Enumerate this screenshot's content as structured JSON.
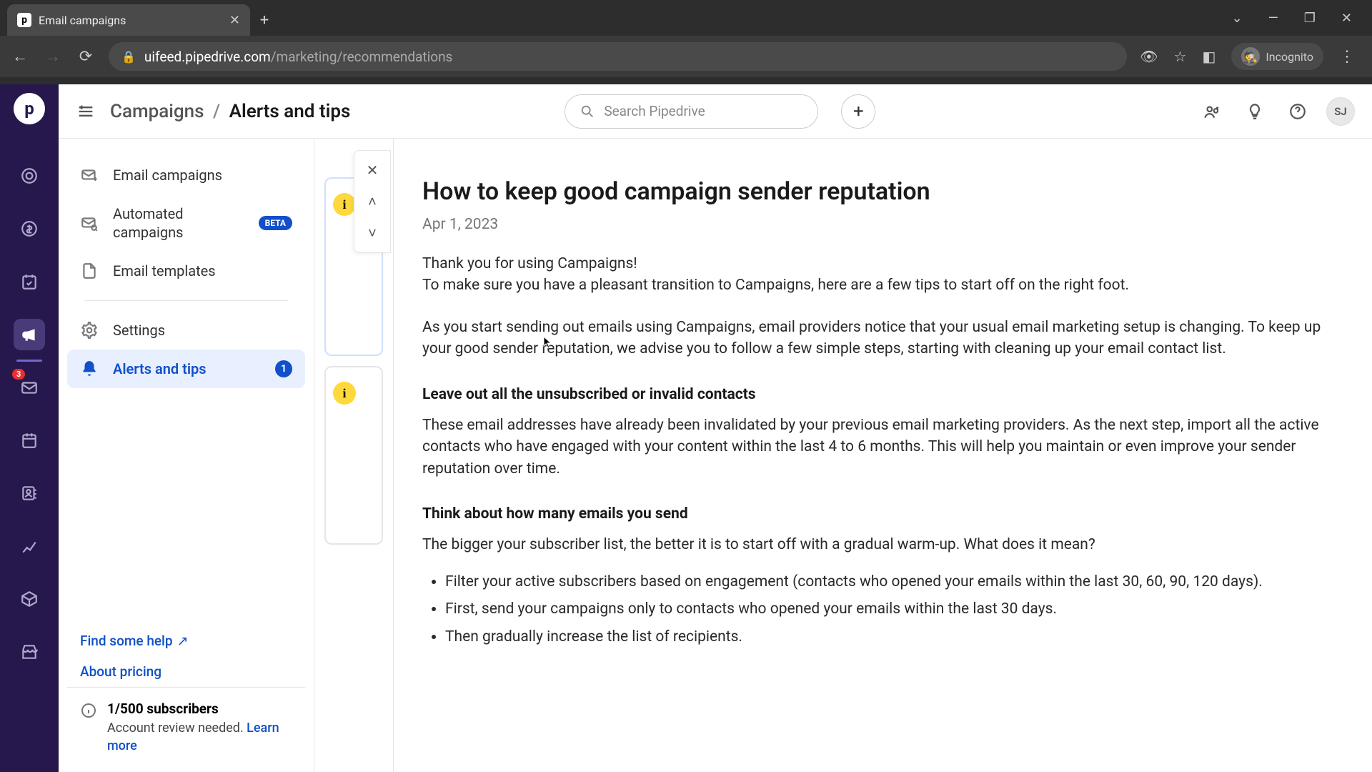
{
  "browser": {
    "tab_title": "Email campaigns",
    "url_host": "uifeed.pipedrive.com",
    "url_path": "/marketing/recommendations",
    "incognito": "Incognito"
  },
  "topbar": {
    "breadcrumb_root": "Campaigns",
    "breadcrumb_current": "Alerts and tips",
    "search_placeholder": "Search Pipedrive",
    "user_initials": "SJ"
  },
  "rail": {
    "mail_badge": "3"
  },
  "sidebar": {
    "items": [
      {
        "label": "Email campaigns"
      },
      {
        "label": "Automated campaigns",
        "beta": "BETA"
      },
      {
        "label": "Email templates"
      },
      {
        "label": "Settings"
      },
      {
        "label": "Alerts and tips",
        "count": "1"
      }
    ],
    "help": "Find some help",
    "pricing": "About pricing",
    "subs_title": "1/500 subscribers",
    "subs_desc": "Account review needed. ",
    "subs_learn": "Learn more"
  },
  "article": {
    "title": "How to keep good campaign sender reputation",
    "date": "Apr 1, 2023",
    "p1a": "Thank you for using Campaigns!",
    "p1b": "To make sure you have a pleasant transition to Campaigns, here are a few tips to start off on the right foot.",
    "p2": "As you start sending out emails using Campaigns, email providers notice that your usual email marketing setup is changing. To keep up your good sender reputation, we advise you to follow a few simple steps, starting with cleaning up your email contact list.",
    "h1": "Leave out all the unsubscribed or invalid contacts",
    "p3": "These email addresses have already been invalidated by your previous email marketing providers. As the next step, import all the active contacts who have engaged with your content within the last 4 to 6 months. This will help you maintain or even improve your sender reputation over time.",
    "h2": "Think about how many emails you send",
    "p4": "The bigger your subscriber list, the better it is to start off with a gradual warm-up. What does it mean?",
    "bullets": [
      "Filter your active subscribers based on engagement (contacts who opened your emails within the last 30, 60, 90, 120 days).",
      "First, send your campaigns only to contacts who opened your emails within the last 30 days.",
      "Then gradually increase the list of recipients."
    ]
  }
}
